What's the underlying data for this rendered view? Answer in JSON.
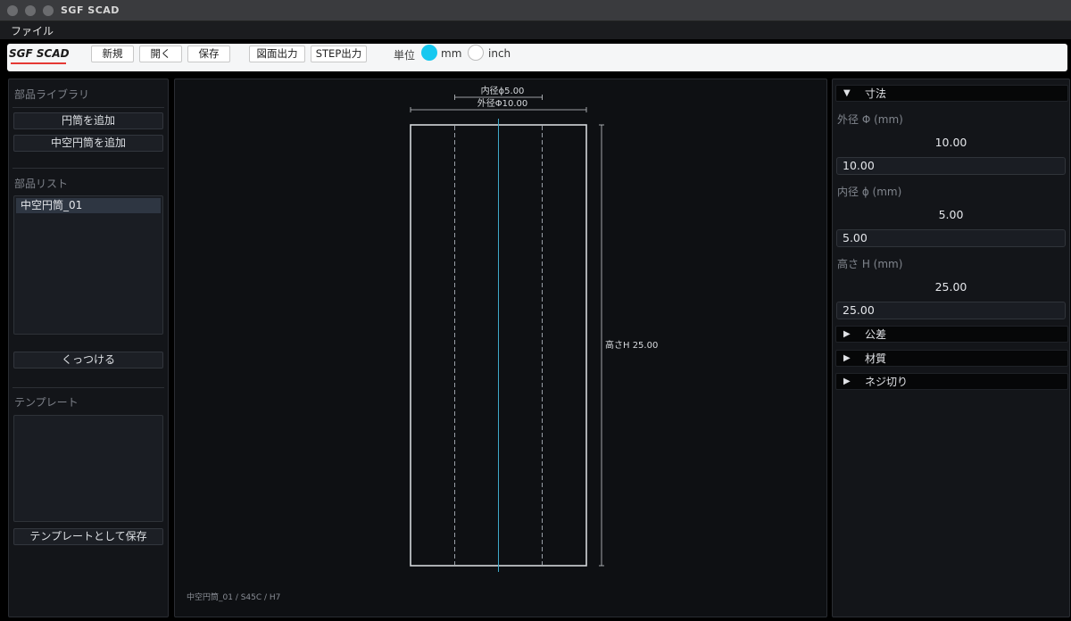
{
  "window": {
    "title": "SGF SCAD"
  },
  "menu": {
    "file": "ファイル"
  },
  "toolbar": {
    "brand": "SGF SCAD",
    "new": "新規",
    "open": "開く",
    "save": "保存",
    "drawing_export": "図面出力",
    "step_export": "STEP出力",
    "unit_label": "単位",
    "unit_mm": "mm",
    "unit_inch": "inch",
    "selected_unit": "mm"
  },
  "left": {
    "library_title": "部品ライブラリ",
    "add_cylinder": "円筒を追加",
    "add_hollow": "中空円筒を追加",
    "parts_title": "部品リスト",
    "parts": [
      "中空円筒_01"
    ],
    "attach": "くっつける",
    "template_title": "テンプレート",
    "save_template": "テンプレートとして保存"
  },
  "canvas": {
    "inner_dim": "内径ϕ5.00",
    "outer_dim": "外径Φ10.00",
    "height_dim": "高さH 25.00",
    "footer": "中空円筒_01 / S45C / H7"
  },
  "right": {
    "dims_header": "寸法",
    "outer_label": "外径 Φ (mm)",
    "outer_value": "10.00",
    "outer_input": "10.00",
    "inner_label": "内径 ϕ (mm)",
    "inner_value": "5.00",
    "inner_input": "5.00",
    "height_label": "高さ H (mm)",
    "height_value": "25.00",
    "height_input": "25.00",
    "tolerance_header": "公差",
    "material_header": "材質",
    "thread_header": "ネジ切り"
  },
  "colors": {
    "accent": "#16c8f0",
    "brand_underline": "#e53935",
    "centerline": "#3fa9c9"
  },
  "icons": {
    "expanded": "triangle-down-icon",
    "collapsed": "triangle-right-icon"
  }
}
